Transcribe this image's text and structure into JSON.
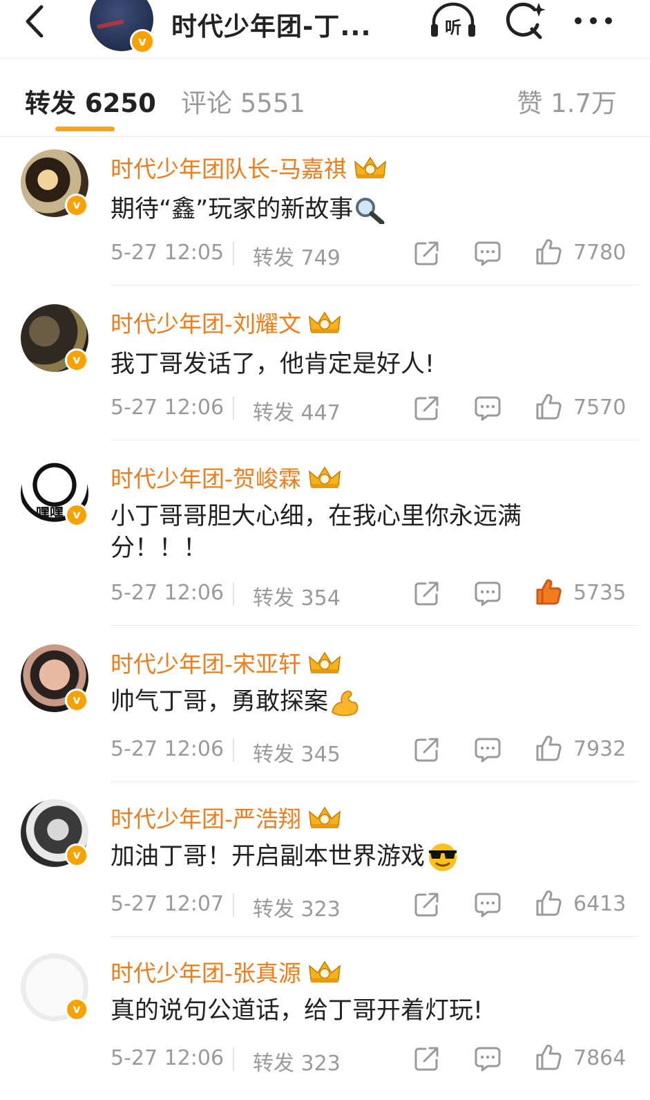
{
  "header": {
    "title": "时代少年团-丁...",
    "listen_label": "听",
    "verified_mark": "v"
  },
  "tabs": {
    "repost": "转发 6250",
    "comment": "评论 5551",
    "like": "赞 1.7万"
  },
  "colors": {
    "accent": "#ffa319",
    "name": "#f07d1a",
    "verified": "#f8a200",
    "liked": "#f07d1a"
  },
  "comments": [
    {
      "name": "时代少年团队长-马嘉祺",
      "text": "期待“鑫”玩家的新故事",
      "emoji": "magnifier-emoji",
      "time": "5-27 12:05",
      "repost": "转发 749",
      "likes": "7780",
      "liked": false
    },
    {
      "name": "时代少年团-刘耀文",
      "text": "我丁哥发话了，他肯定是好人!",
      "emoji": "",
      "time": "5-27 12:06",
      "repost": "转发 447",
      "likes": "7570",
      "liked": false
    },
    {
      "name": "时代少年团-贺峻霖",
      "text": "小丁哥哥胆大心细，在我心里你永远满分！！！",
      "emoji": "",
      "avatar_text": "嘿嘿",
      "time": "5-27 12:06",
      "repost": "转发 354",
      "likes": "5735",
      "liked": true
    },
    {
      "name": "时代少年团-宋亚轩",
      "text": "帅气丁哥，勇敢探案",
      "emoji": "muscle-emoji",
      "time": "5-27 12:06",
      "repost": "转发 345",
      "likes": "7932",
      "liked": false
    },
    {
      "name": "时代少年团-严浩翔",
      "text": "加油丁哥！开启副本世界游戏",
      "emoji": "sunglasses-emoji",
      "time": "5-27 12:07",
      "repost": "转发 323",
      "likes": "6413",
      "liked": false
    },
    {
      "name": "时代少年团-张真源",
      "text": "真的说句公道话，给丁哥开着灯玩!",
      "emoji": "",
      "time": "5-27 12:06",
      "repost": "转发 323",
      "likes": "7864",
      "liked": false
    }
  ]
}
